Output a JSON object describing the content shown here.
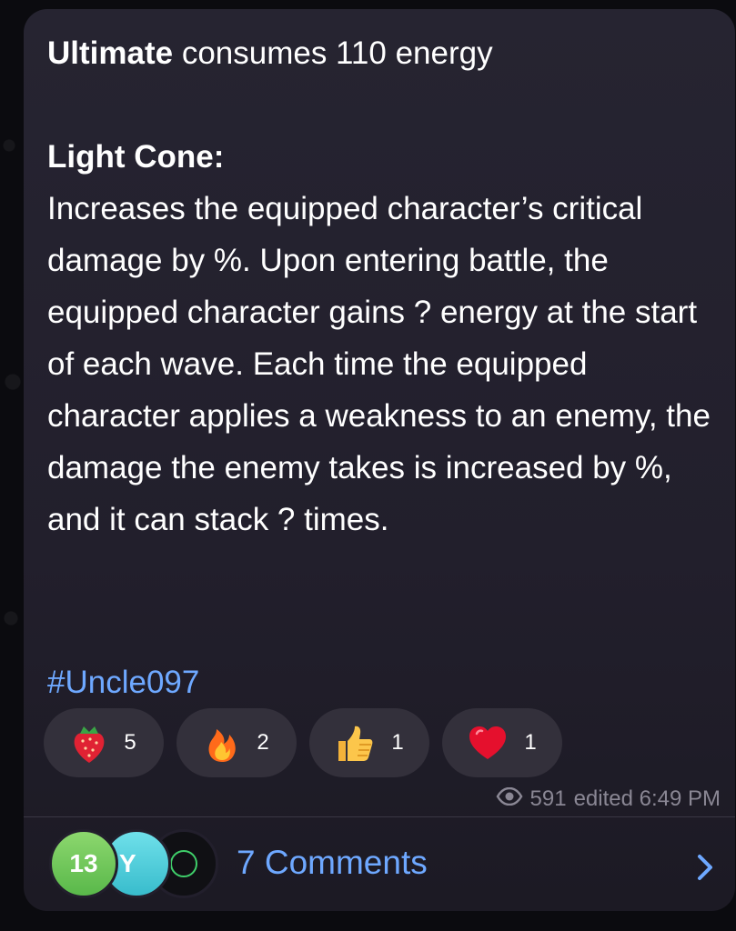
{
  "message": {
    "ultimate_bold": "Ultimate",
    "ultimate_rest": " consumes 110 energy",
    "light_cone_title": "Light Cone:",
    "light_cone_body": "Increases the equipped character’s critical damage by %. Upon entering battle, the equipped character gains ? energy at the start of each wave. Each time the equipped character applies a weakness to an enemy, the damage the enemy takes is increased by %, and it can stack ? times.",
    "hashtag": "#Uncle097"
  },
  "reactions": [
    {
      "icon": "strawberry-icon",
      "count": "5"
    },
    {
      "icon": "fire-icon",
      "count": "2"
    },
    {
      "icon": "thumbs-up-icon",
      "count": "1"
    },
    {
      "icon": "heart-icon",
      "count": "1"
    }
  ],
  "meta": {
    "views": "591",
    "status": "edited 6:49 PM",
    "icon": "eye-icon"
  },
  "comments": {
    "label": "7 Comments",
    "avatars": [
      {
        "text": "13",
        "color": "#59b84a"
      },
      {
        "text": "Y",
        "color": "#38bccc"
      },
      {
        "text": "",
        "color": "#101014"
      }
    ],
    "icon": "chevron-right-icon"
  },
  "colors": {
    "bubble": "#221f2c",
    "link": "#6ea8ff",
    "meta": "#8a8794",
    "reaction_pill": "#33303b"
  }
}
